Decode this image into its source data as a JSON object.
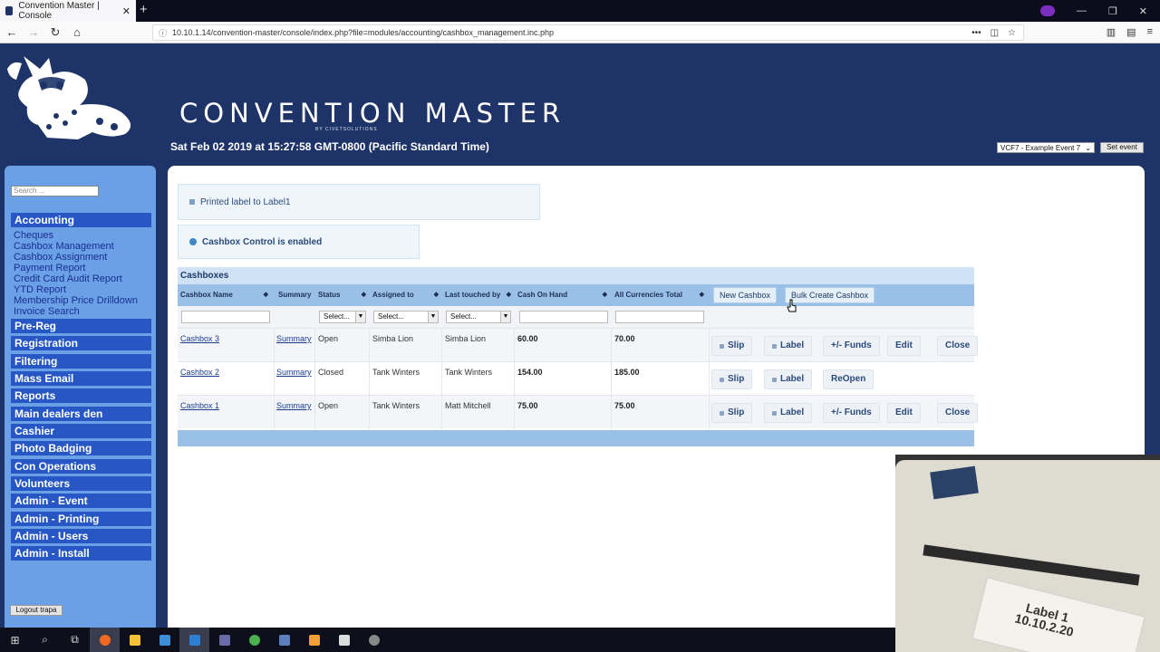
{
  "browser": {
    "tab_title": "Convention Master | Console",
    "url": "10.10.1.14/convention-master/console/index.php?file=modules/accounting/cashbox_management.inc.php"
  },
  "header": {
    "brand": "CONVENTION MASTER",
    "brand_sub": "BY CIVETSOLUTIONS",
    "datetime": "Sat Feb 02 2019 at 15:27:58 GMT-0800 (Pacific Standard Time)",
    "event_selected": "VCF7 - Example Event 7",
    "set_event_label": "Set event"
  },
  "sidebar": {
    "search_placeholder": "Search ...",
    "accounting": {
      "label": "Accounting",
      "items": [
        "Cheques",
        "Cashbox Management",
        "Cashbox Assignment",
        "Payment Report",
        "Credit Card Audit Report",
        "YTD Report",
        "Membership Price Drilldown",
        "Invoice Search"
      ]
    },
    "sections": [
      "Pre-Reg",
      "Registration",
      "Filtering",
      "Mass Email",
      "Reports",
      "Main dealers den",
      "Cashier",
      "Photo Badging",
      "Con Operations",
      "Volunteers",
      "Admin - Event",
      "Admin - Printing",
      "Admin - Users",
      "Admin - Install"
    ],
    "logout_label": "Logout trapa"
  },
  "notices": {
    "printed": "Printed label to Label1",
    "cashbox_control": "Cashbox Control is enabled"
  },
  "grid": {
    "title": "Cashboxes",
    "columns": [
      "Cashbox Name",
      "Summary",
      "Status",
      "Assigned to",
      "Last touched by",
      "Cash On Hand",
      "All Currencies Total"
    ],
    "new_button": "New Cashbox",
    "bulk_button": "Bulk Create Cashbox",
    "select_placeholder": "Select...",
    "rows": [
      {
        "name": "Cashbox 3",
        "summary": "Summary",
        "status": "Open",
        "assigned": "Simba Lion",
        "touched": "Simba Lion",
        "cash": "60.00",
        "total": "70.00",
        "actions": [
          "Slip",
          "Label",
          "+/- Funds",
          "Edit",
          "Close"
        ]
      },
      {
        "name": "Cashbox 2",
        "summary": "Summary",
        "status": "Closed",
        "assigned": "Tank Winters",
        "touched": "Tank Winters",
        "cash": "154.00",
        "total": "185.00",
        "actions": [
          "Slip",
          "Label",
          "ReOpen"
        ]
      },
      {
        "name": "Cashbox 1",
        "summary": "Summary",
        "status": "Open",
        "assigned": "Tank Winters",
        "touched": "Matt Mitchell",
        "cash": "75.00",
        "total": "75.00",
        "actions": [
          "Slip",
          "Label",
          "+/- Funds",
          "Edit",
          "Close"
        ]
      }
    ]
  },
  "webcam": {
    "label_text_1": "Label 1",
    "label_text_2": "10.10.2.20"
  },
  "colors": {
    "page_bg": "#1e3468",
    "sidebar_bg": "#6aa0e6",
    "section_bg": "#2757c5",
    "grid_header": "#9bc0e8"
  }
}
